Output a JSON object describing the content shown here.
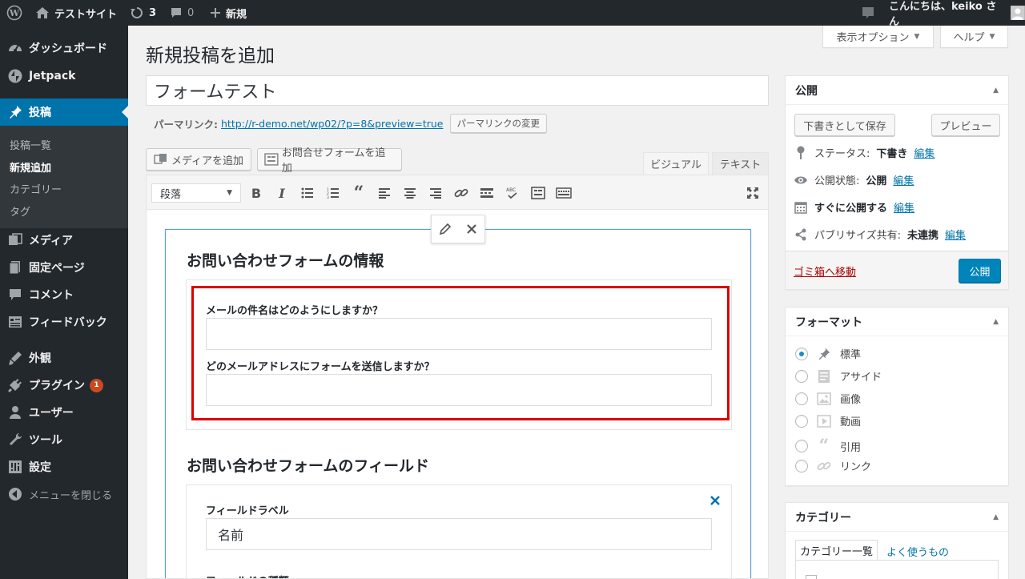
{
  "admin_bar": {
    "site_name": "テストサイト",
    "updates_count": "3",
    "comments_count": "0",
    "new_label": "新規",
    "greeting": "こんにちは、keiko さん"
  },
  "sidebar": {
    "items": [
      {
        "label": "ダッシュボード",
        "icon": "dashboard-icon"
      },
      {
        "label": "Jetpack",
        "icon": "jetpack-icon"
      },
      {
        "label": "投稿",
        "icon": "pin-icon"
      },
      {
        "label": "メディア",
        "icon": "media-icon"
      },
      {
        "label": "固定ページ",
        "icon": "page-icon"
      },
      {
        "label": "コメント",
        "icon": "comment-icon"
      },
      {
        "label": "フィードバック",
        "icon": "feedback-icon"
      },
      {
        "label": "外観",
        "icon": "appearance-icon"
      },
      {
        "label": "プラグイン",
        "icon": "plugin-icon",
        "badge": "1"
      },
      {
        "label": "ユーザー",
        "icon": "user-icon"
      },
      {
        "label": "ツール",
        "icon": "tool-icon"
      },
      {
        "label": "設定",
        "icon": "settings-icon"
      },
      {
        "label": "メニューを閉じる",
        "icon": "collapse-icon"
      }
    ],
    "submenu": [
      "投稿一覧",
      "新規追加",
      "カテゴリー",
      "タグ"
    ]
  },
  "header": {
    "screen_options": "表示オプション",
    "help": "ヘルプ",
    "page_title": "新規投稿を追加"
  },
  "post": {
    "title_value": "フォームテスト",
    "permalink_label": "パーマリンク:",
    "permalink_url": "http://r-demo.net/wp02/?p=8&preview=true",
    "permalink_button": "パーマリンクの変更"
  },
  "editor": {
    "add_media": "メディアを追加",
    "add_contact_form": "お問合せフォームを追加",
    "tab_visual": "ビジュアル",
    "tab_text": "テキスト",
    "format_select": "段落",
    "section1_title": "お問い合わせフォームの情報",
    "field1_label": "メールの件名はどのようにしますか？",
    "field1_value": "",
    "field2_label": "どのメールアドレスにフォームを送信しますか？",
    "field2_value": "",
    "section2_title": "お問い合わせフォームのフィールド",
    "field_label_label": "フィールドラベル",
    "field_label_value": "名前",
    "field_type_label": "フィールドの種類"
  },
  "publish": {
    "title": "公開",
    "save_draft": "下書きとして保存",
    "preview": "プレビュー",
    "status_label": "ステータス:",
    "status_value": "下書き",
    "visibility_label": "公開状態:",
    "visibility_value": "公開",
    "schedule_label": "すぐに公開する",
    "publicize_label": "パブリサイズ共有:",
    "publicize_value": "未連携",
    "edit_link": "編集",
    "trash": "ゴミ箱へ移動",
    "publish_button": "公開"
  },
  "format": {
    "title": "フォーマット",
    "options": [
      "標準",
      "アサイド",
      "画像",
      "動画",
      "引用",
      "リンク"
    ],
    "selected": "標準"
  },
  "categories": {
    "title": "カテゴリー",
    "tab_all": "カテゴリー一覧",
    "tab_popular": "よく使うもの"
  },
  "colors": {
    "admin_dark": "#23282d",
    "accent_blue": "#0073aa",
    "highlight_red": "#dd0000",
    "badge_orange": "#ca4a1f"
  }
}
